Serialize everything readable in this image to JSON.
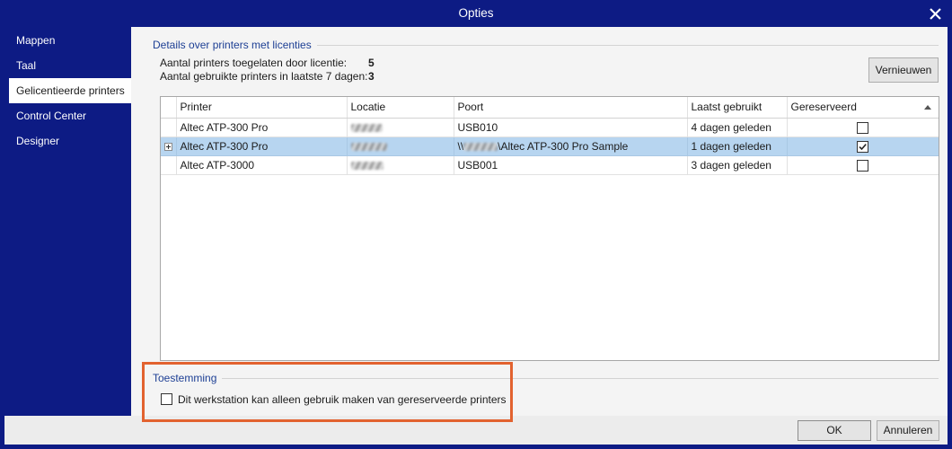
{
  "window": {
    "title": "Opties"
  },
  "sidebar": {
    "items": [
      {
        "label": "Mappen",
        "selected": false
      },
      {
        "label": "Taal",
        "selected": false
      },
      {
        "label": "Gelicentieerde printers",
        "selected": true
      },
      {
        "label": "Control Center",
        "selected": false
      },
      {
        "label": "Designer",
        "selected": false
      }
    ]
  },
  "license_details": {
    "heading": "Details over printers met licenties",
    "allowed_label": "Aantal printers toegelaten door licentie:",
    "allowed_value": 5,
    "used_label": "Aantal gebruikte printers in laatste 7 dagen:",
    "used_value": 3,
    "refresh_label": "Vernieuwen"
  },
  "table": {
    "columns": [
      "Printer",
      "Locatie",
      "Poort",
      "Laatst gebruikt",
      "Gereserveerd"
    ],
    "rows": [
      {
        "printer": "Altec ATP-300 Pro",
        "port": "USB010",
        "last_used": "4 dagen geleden",
        "reserved": false,
        "selected": false
      },
      {
        "printer": "Altec ATP-300 Pro",
        "port_prefix": "\\\\",
        "port_suffix": "\\Altec ATP-300 Pro Sample",
        "last_used": "1 dagen geleden",
        "reserved": true,
        "selected": true
      },
      {
        "printer": "Altec ATP-3000",
        "port": "USB001",
        "last_used": "3 dagen geleden",
        "reserved": false,
        "selected": false
      }
    ]
  },
  "permission": {
    "heading": "Toestemming",
    "reserved_only_label": "Dit werkstation kan alleen gebruik maken van gereserveerde printers",
    "reserved_only_checked": false
  },
  "footer": {
    "ok_label": "OK",
    "cancel_label": "Annuleren"
  },
  "icons": {
    "close": "close-icon",
    "sort": "sort-ascending-icon",
    "expand": "expand-plus-icon",
    "check": "checkmark-icon"
  },
  "colors": {
    "frame": "#0d1b84",
    "heading_text": "#1d3f94",
    "selected_row": "#b7d5f0",
    "highlight": "#e2622f"
  }
}
